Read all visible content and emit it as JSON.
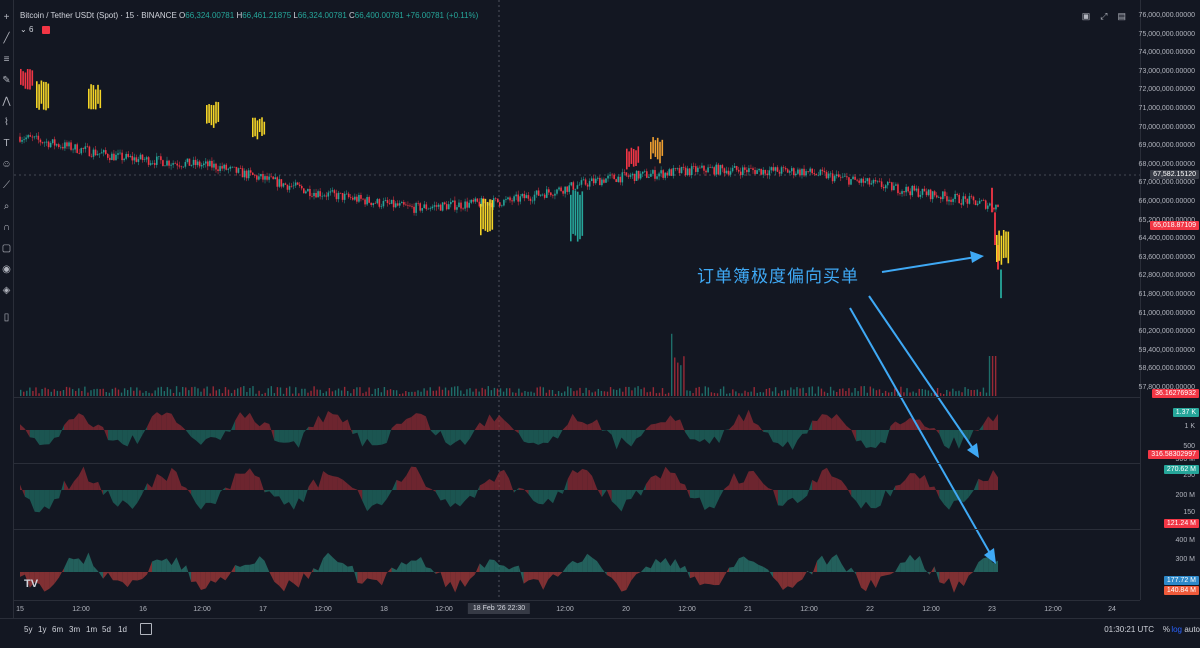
{
  "header": {
    "symbol": "Bitcoin / Tether USDt (Spot) · 15 · BINANCE",
    "o_label": "O",
    "o_value": "66,324.00781",
    "h_label": "H",
    "h_value": "66,461.21875",
    "l_label": "L",
    "l_value": "66,324.00781",
    "c_label": "C",
    "c_value": "66,400.00781",
    "change": "+76.00781 (+0.11%)",
    "indicator_count": "6"
  },
  "colors": {
    "up": "#26a69a",
    "down": "#f23645",
    "yellow": "#f5d527",
    "orange": "#f0a030",
    "annotation": "#3fa9f5",
    "background": "#131722"
  },
  "y_ticks_main": [
    "76,000,000",
    "75,000,000",
    "74,000,000",
    "73,000,000",
    "72,000,000",
    "71,000,000",
    "70,000,000",
    "69,000,000",
    "68,000,000",
    "67,000,000",
    "66,000,000",
    "65,200,000",
    "64,400,000",
    "63,600,000",
    "62,800,000",
    "61,800,000",
    "61,000,000",
    "60,200,000",
    "59,400,000",
    "58,600,000",
    "57,800,000"
  ],
  "y_tags": {
    "current": "67,582.15120",
    "last": "65,018.87109",
    "volume": "36.16276932",
    "p1": "1.37 K",
    "p2_top": "316.58302997",
    "p2": "270.62 M",
    "p2_low": "121.24 M",
    "p3a": "177.72 M",
    "p3b": "140.84 M"
  },
  "y_ticks_panes": [
    "1 K",
    "500",
    "300 M",
    "250",
    "200 M",
    "150",
    "400 M",
    "300 M"
  ],
  "x_ticks": [
    "15",
    "12:00",
    "16",
    "12:00",
    "17",
    "12:00",
    "18",
    "12:00",
    "12:00",
    "20",
    "12:00",
    "21",
    "12:00",
    "22",
    "12:00",
    "23",
    "12:00",
    "24"
  ],
  "crosshair_time": "18 Feb '26   22:30",
  "ranges": [
    "5y",
    "1y",
    "6m",
    "3m",
    "1m",
    "5d",
    "1d"
  ],
  "clock": "01:30:21 UTC",
  "scale_pct": "%",
  "scale_log": "log",
  "scale_auto": "auto",
  "annotation_text": "订单簿极度偏向买单",
  "tv_logo": "TV",
  "toolbar_icons": [
    "crosshair-icon",
    "trend-line-icon",
    "fib-icon",
    "brush-icon",
    "text-icon",
    "pattern-icon",
    "measure-icon",
    "zoom-icon",
    "magnet-icon",
    "lock-icon",
    "eye-icon",
    "trash-icon"
  ],
  "chart_data": {
    "type": "candlestick",
    "x": [
      "15",
      "16",
      "17",
      "18",
      "19",
      "20",
      "21",
      "22",
      "23"
    ],
    "series": [
      {
        "close": [
          69900,
          68900,
          68450,
          67200,
          66400,
          66750,
          67850,
          68300,
          68200,
          67350,
          66500
        ]
      }
    ],
    "ylim": [
      57800,
      76000
    ]
  }
}
